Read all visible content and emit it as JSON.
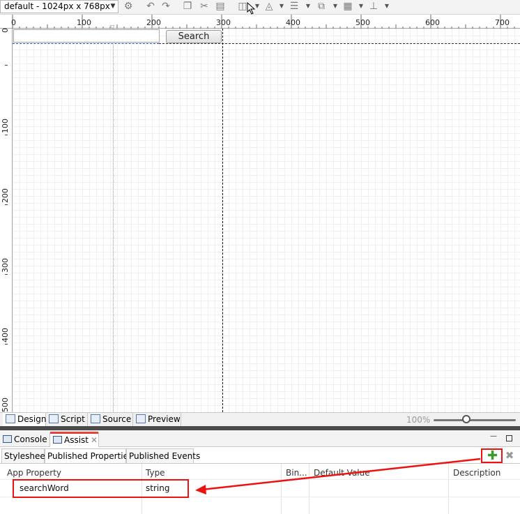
{
  "toolbar": {
    "resolution": "default - 1024px x 768px",
    "icons": [
      "settings-icon",
      "undo-icon",
      "redo-icon",
      "copy-icon",
      "cut-icon",
      "paste-icon",
      "align-left-icon",
      "align-top-icon",
      "distribute-icon",
      "arrange-icon",
      "grid-icon",
      "position-icon"
    ]
  },
  "ruler": {
    "top_labels": [
      "0",
      "100",
      "200",
      "300",
      "400",
      "500",
      "600",
      "700"
    ],
    "left_labels": [
      "0",
      "100",
      "200",
      "300",
      "400",
      "500"
    ]
  },
  "canvas": {
    "search_input_value": "",
    "search_button_label": "Search"
  },
  "editor_tabs": [
    "Design",
    "Script",
    "Source",
    "Preview"
  ],
  "zoom": {
    "label": "100%",
    "level": 1.0
  },
  "panel": {
    "tabs": [
      "Console",
      "Assist"
    ],
    "sub_tabs": [
      "Stylesheet",
      "Published Properties",
      "Published Events"
    ],
    "columns": [
      "App Property",
      "Type",
      "Bin...",
      "Default Value",
      "Description"
    ],
    "rows": [
      {
        "app_property": "searchWord",
        "type": "string",
        "binding": "",
        "default_value": "",
        "description": ""
      }
    ]
  },
  "colors": {
    "highlight": "#e11111",
    "add_icon": "#3a9b2c",
    "active_tab_accent": "#e8423c"
  }
}
